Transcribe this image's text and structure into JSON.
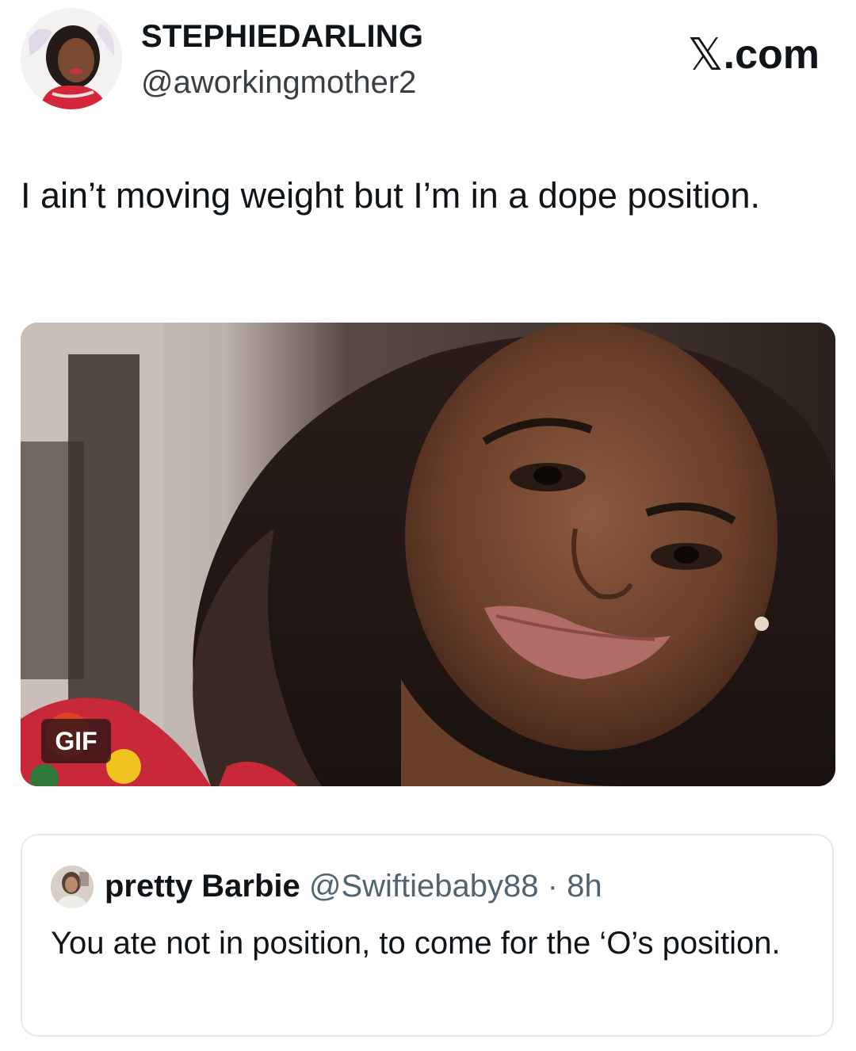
{
  "author": {
    "display_name": "STEPHIEDARLING",
    "handle": "@aworkingmother2",
    "avatar_icon": "profile-photo"
  },
  "brand": {
    "x_glyph": "𝕏",
    "suffix": ".com"
  },
  "tweet": {
    "text": "I ain’t moving weight but I’m in a dope position."
  },
  "media": {
    "type_badge": "GIF"
  },
  "quoted_tweet": {
    "display_name": "pretty Barbie",
    "handle": "@Swiftiebaby88",
    "separator": "·",
    "time": "8h",
    "text": "You ate not in position, to come for the ‘O’s position."
  },
  "colors": {
    "text_primary": "#0f1419",
    "text_secondary": "#536471",
    "border": "#e6e9ec"
  }
}
